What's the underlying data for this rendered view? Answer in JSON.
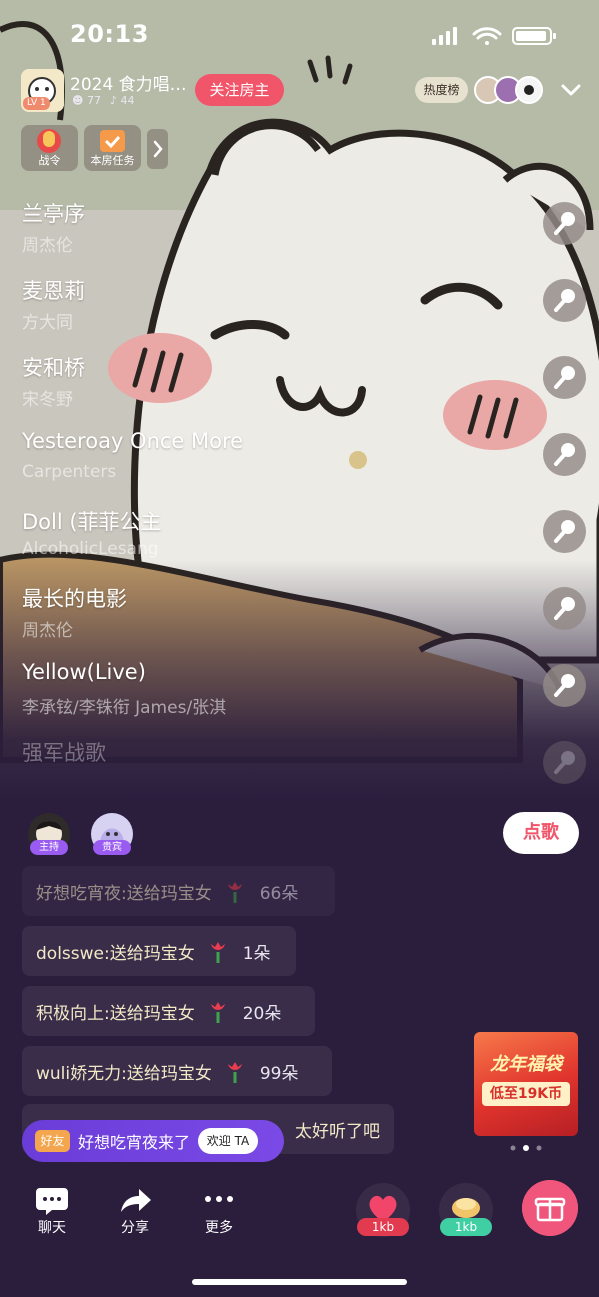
{
  "status_bar": {
    "time": "20:13"
  },
  "header": {
    "room_level": "LV 1",
    "room_title": "2024 食力唱…",
    "member_count": "77",
    "mic_count": "44",
    "follow_label": "关注房主",
    "hot_rank_label": "热度榜"
  },
  "badges": [
    {
      "label": "战令"
    },
    {
      "label": "本房任务"
    }
  ],
  "songs": [
    {
      "title": "兰亭序",
      "artist": "周杰伦"
    },
    {
      "title": "麦恩莉",
      "artist": "方大同"
    },
    {
      "title": "安和桥",
      "artist": "宋冬野"
    },
    {
      "title": "Yesteroay Once More",
      "artist": "Carpenters"
    },
    {
      "title": "Doll (菲菲公主",
      "artist": "AlcoholicLesang"
    },
    {
      "title": "最长的电影",
      "artist": "周杰伦"
    },
    {
      "title": "Yellow(Live)",
      "artist": "李承铉/李铢衔 James/张淇"
    },
    {
      "title": "强军战歌",
      "artist": ""
    }
  ],
  "hosts": [
    {
      "role": "主持"
    },
    {
      "role": "贵宾"
    }
  ],
  "request_song_label": "点歌",
  "chat": [
    {
      "text": "好想吃宵夜:送给玛宝女",
      "count": "66朵"
    },
    {
      "text": "dolsswe:送给玛宝女",
      "count": "1朵"
    },
    {
      "text": "积极向上:送给玛宝女",
      "count": "20朵"
    },
    {
      "text": "wuli娇无力:送给玛宝女",
      "count": "99朵"
    },
    {
      "text": "太好听了吧",
      "count": ""
    }
  ],
  "welcome": {
    "tag": "好友",
    "text": "好想吃宵夜来了",
    "button": "欢迎 TA"
  },
  "promo": {
    "title": "龙年福袋",
    "subtitle": "低至19K币"
  },
  "toolbar": {
    "chat_label": "聊天",
    "share_label": "分享",
    "more_label": "更多",
    "gift1_value": "1kb",
    "gift2_value": "1kb"
  },
  "colors": {
    "accent_pink": "#f1556a",
    "gift_pink": "#f0567c",
    "welcome_purple": "#6a3cd8",
    "role_purple": "#9a5cf0"
  }
}
